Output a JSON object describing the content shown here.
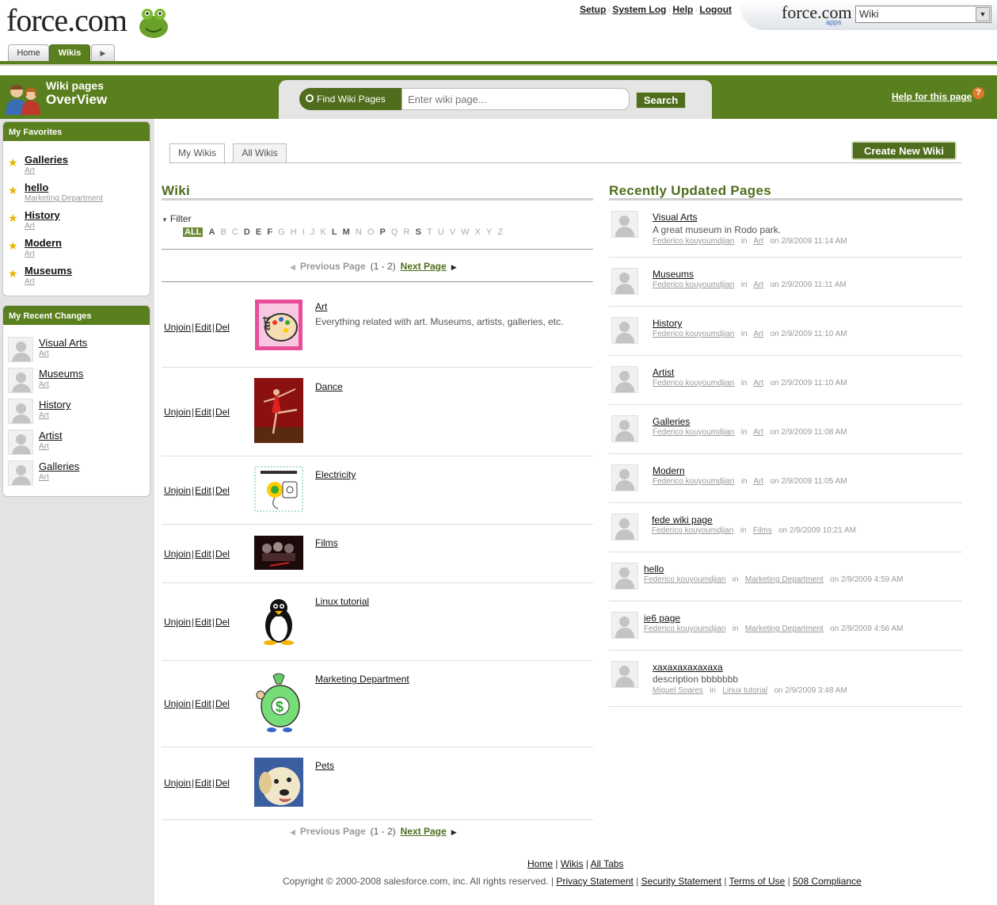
{
  "header": {
    "logo_text": "force.com",
    "links": [
      "Setup",
      "System Log",
      "Help",
      "Logout"
    ],
    "app_logo": "force.com",
    "app_logo_sub": "apps",
    "app_select_value": "Wiki"
  },
  "tabs": [
    "Home",
    "Wikis"
  ],
  "page_header": {
    "title_line1": "Wiki pages",
    "title_line2": "OverView",
    "find_label": "Find Wiki Pages",
    "search_placeholder": "Enter wiki page...",
    "search_button": "Search",
    "help_link": "Help for this page",
    "help_icon": "?"
  },
  "sidebar": {
    "favorites_title": "My Favorites",
    "favorites": [
      {
        "name": "Galleries",
        "sub": "Art"
      },
      {
        "name": "hello",
        "sub": "Marketing Department"
      },
      {
        "name": "History",
        "sub": "Art"
      },
      {
        "name": "Modern",
        "sub": "Art"
      },
      {
        "name": "Museums",
        "sub": "Art"
      }
    ],
    "recent_title": "My Recent Changes",
    "recent": [
      {
        "name": "Visual Arts",
        "sub": "Art"
      },
      {
        "name": "Museums",
        "sub": "Art"
      },
      {
        "name": "History",
        "sub": "Art"
      },
      {
        "name": "Artist",
        "sub": "Art"
      },
      {
        "name": "Galleries",
        "sub": "Art"
      }
    ]
  },
  "main": {
    "subtabs": [
      "My Wikis",
      "All Wikis"
    ],
    "create_button": "Create New Wiki",
    "wiki_title": "Wiki",
    "filter_label": "Filter",
    "letters": [
      "ALL",
      "A",
      "B",
      "C",
      "D",
      "E",
      "F",
      "G",
      "H",
      "I",
      "J",
      "K",
      "L",
      "M",
      "N",
      "O",
      "P",
      "Q",
      "R",
      "S",
      "T",
      "U",
      "V",
      "W",
      "X",
      "Y",
      "Z"
    ],
    "pager": {
      "prev": "Previous Page",
      "count": "(1 - 2)",
      "next": "Next Page"
    },
    "actions": {
      "unjoin": "Unjoin",
      "edit": "Edit",
      "del": "Del"
    },
    "wikis": [
      {
        "name": "Art",
        "desc": "Everything related with art. Museums, artists, galleries, etc."
      },
      {
        "name": "Dance",
        "desc": ""
      },
      {
        "name": "Electricity",
        "desc": ""
      },
      {
        "name": "Films",
        "desc": ""
      },
      {
        "name": "Linux tutorial",
        "desc": ""
      },
      {
        "name": "Marketing Department",
        "desc": ""
      },
      {
        "name": "Pets",
        "desc": ""
      }
    ],
    "recent_title": "Recently Updated Pages",
    "in_word": "in",
    "recent_pages": [
      {
        "title": "Visual Arts",
        "desc": "A great museum in Rodo park.",
        "author": "Federico kouyoumdjian",
        "wiki": "Art",
        "date": "on 2/9/2009 11:14 AM"
      },
      {
        "title": "Museums",
        "desc": "",
        "author": "Federico kouyoumdjian",
        "wiki": "Art",
        "date": "on 2/9/2009 11:11 AM"
      },
      {
        "title": "History",
        "desc": "",
        "author": "Federico kouyoumdjian",
        "wiki": "Art",
        "date": "on 2/9/2009 11:10 AM"
      },
      {
        "title": "Artist",
        "desc": "",
        "author": "Federico kouyoumdjian",
        "wiki": "Art",
        "date": "on 2/9/2009 11:10 AM"
      },
      {
        "title": "Galleries",
        "desc": "",
        "author": "Federico kouyoumdjian",
        "wiki": "Art",
        "date": "on 2/9/2009 11:08 AM"
      },
      {
        "title": "Modern",
        "desc": "",
        "author": "Federico kouyoumdjian",
        "wiki": "Art",
        "date": "on 2/9/2009 11:05 AM"
      },
      {
        "title": "fede wiki page",
        "desc": "",
        "author": "Federico kouyoumdjian",
        "wiki": "Films",
        "date": "on 2/9/2009 10:21 AM"
      },
      {
        "title": "hello",
        "desc": "",
        "author": "Federico kouyoumdjian",
        "wiki": "Marketing Department",
        "date": "on 2/9/2009 4:59 AM"
      },
      {
        "title": "ie6 page",
        "desc": "",
        "author": "Federico kouyoumdjian",
        "wiki": "Marketing Department",
        "date": "on 2/9/2009 4:56 AM"
      },
      {
        "title": "xaxaxaxaxaxaxa",
        "desc": "description bbbbbbb",
        "author": "Miguel Soares",
        "wiki": "Linux tutorial",
        "date": "on 2/9/2009 3:48 AM"
      }
    ]
  },
  "footer": {
    "links": [
      "Home",
      "Wikis",
      "All Tabs"
    ],
    "copyright": "Copyright © 2000-2008 salesforce.com, inc. All rights reserved. |",
    "legal_links": [
      "Privacy Statement",
      "Security Statement",
      "Terms of Use",
      "508 Compliance"
    ]
  },
  "colors": {
    "brand_green": "#5a7f1e",
    "dark_green": "#4f6d1d"
  }
}
